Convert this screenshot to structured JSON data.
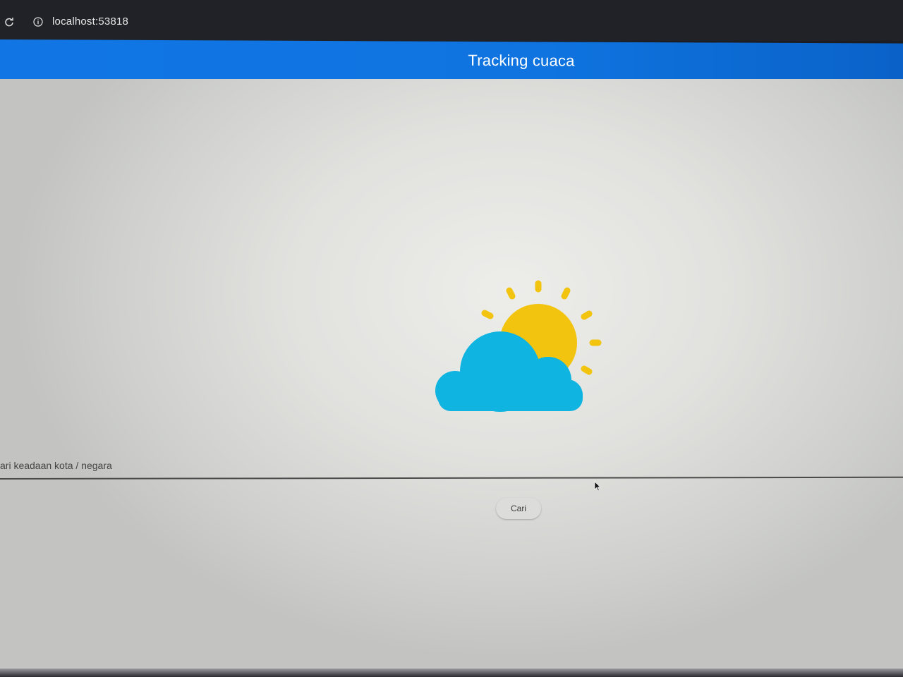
{
  "browser": {
    "url": "localhost:53818",
    "reload_icon": "reload-icon",
    "info_icon": "info-icon"
  },
  "app_bar": {
    "title": "Tracking cuaca",
    "color": "#1176e4"
  },
  "main": {
    "illustration": "partly-cloudy-icon",
    "search": {
      "label": "ari keadaan kota / negara",
      "value": ""
    },
    "search_button_label": "Cari"
  },
  "colors": {
    "sun": "#f2c40f",
    "cloud": "#0fb4e0"
  }
}
